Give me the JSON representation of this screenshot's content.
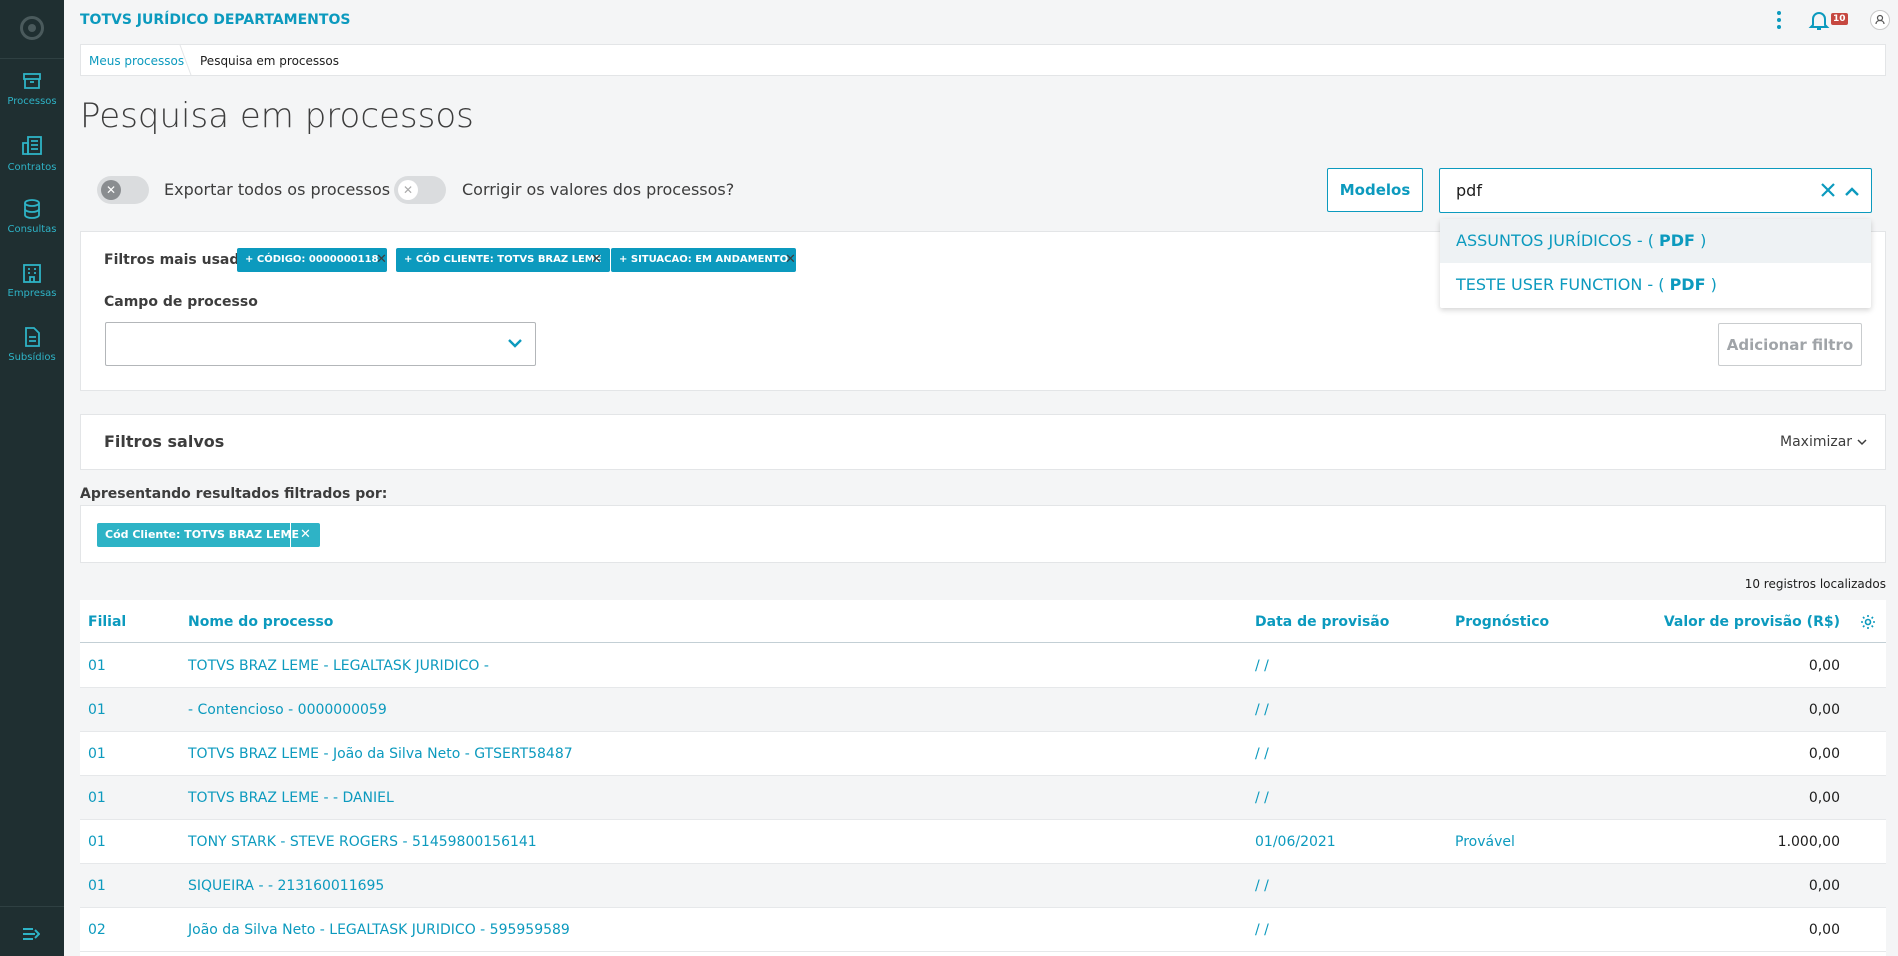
{
  "sidebar": {
    "items": [
      {
        "label": "Processos",
        "icon": "archive-box-icon"
      },
      {
        "label": "Contratos",
        "icon": "contract-icon"
      },
      {
        "label": "Consultas",
        "icon": "database-icon"
      },
      {
        "label": "Empresas",
        "icon": "building-icon"
      },
      {
        "label": "Subsídios",
        "icon": "document-icon"
      }
    ]
  },
  "header": {
    "title": "TOTVS JURÍDICO DEPARTAMENTOS",
    "notification_count": "10"
  },
  "breadcrumb": [
    "Meus processos",
    "Pesquisa em processos"
  ],
  "page_title": "Pesquisa em processos",
  "switches": {
    "export_all": "Exportar todos os processos",
    "correct_values": "Corrigir os valores dos processos?"
  },
  "toolbar": {
    "modelos": "Modelos",
    "search_value": "pdf"
  },
  "search_results": [
    {
      "prefix": "ASSUNTOS JURÍDICOS - ( ",
      "match": "PDF",
      "suffix": " )"
    },
    {
      "prefix": "TESTE USER FUNCTION - ( ",
      "match": "PDF",
      "suffix": " )"
    }
  ],
  "filters": {
    "label": "Filtros mais usados",
    "chips": [
      "+ CÓDIGO: 0000000118",
      "+ CÓD CLIENTE: TOTVS BRAZ LEME",
      "+ SITUACAO: EM ANDAMENTO"
    ],
    "campo_label": "Campo de processo",
    "add_button": "Adicionar filtro"
  },
  "saved_filters": {
    "title": "Filtros salvos",
    "maximize": "Maximizar"
  },
  "results": {
    "label": "Apresentando resultados filtrados por:",
    "tag": "Cód Cliente: TOTVS BRAZ LEME",
    "count": "10 registros localizados"
  },
  "colors": {
    "accent": "#0c9abe",
    "sidebar_bg": "#1f2f31",
    "sidebar_icon": "#2eb3c6",
    "badge": "#c64840"
  },
  "table": {
    "columns": [
      "Filial",
      "Nome do processo",
      "Data de provisão",
      "Prognóstico",
      "Valor de provisão (R$)"
    ],
    "rows": [
      {
        "filial": "01",
        "nome": "TOTVS BRAZ LEME - LEGALTASK JURIDICO -",
        "data": "/ /",
        "prognostico": "",
        "valor": "0,00"
      },
      {
        "filial": "01",
        "nome": "- Contencioso - 0000000059",
        "data": "/ /",
        "prognostico": "",
        "valor": "0,00"
      },
      {
        "filial": "01",
        "nome": "TOTVS BRAZ LEME - João da Silva Neto - GTSERT58487",
        "data": "/ /",
        "prognostico": "",
        "valor": "0,00"
      },
      {
        "filial": "01",
        "nome": "TOTVS BRAZ LEME - - DANIEL",
        "data": "/ /",
        "prognostico": "",
        "valor": "0,00"
      },
      {
        "filial": "01",
        "nome": "TONY STARK - STEVE ROGERS - 51459800156141",
        "data": "01/06/2021",
        "prognostico": "Provável",
        "valor": "1.000,00"
      },
      {
        "filial": "01",
        "nome": "SIQUEIRA - - 213160011695",
        "data": "/ /",
        "prognostico": "",
        "valor": "0,00"
      },
      {
        "filial": "02",
        "nome": "João da Silva Neto - LEGALTASK JURIDICO - 595959589",
        "data": "/ /",
        "prognostico": "",
        "valor": "0,00"
      }
    ]
  }
}
